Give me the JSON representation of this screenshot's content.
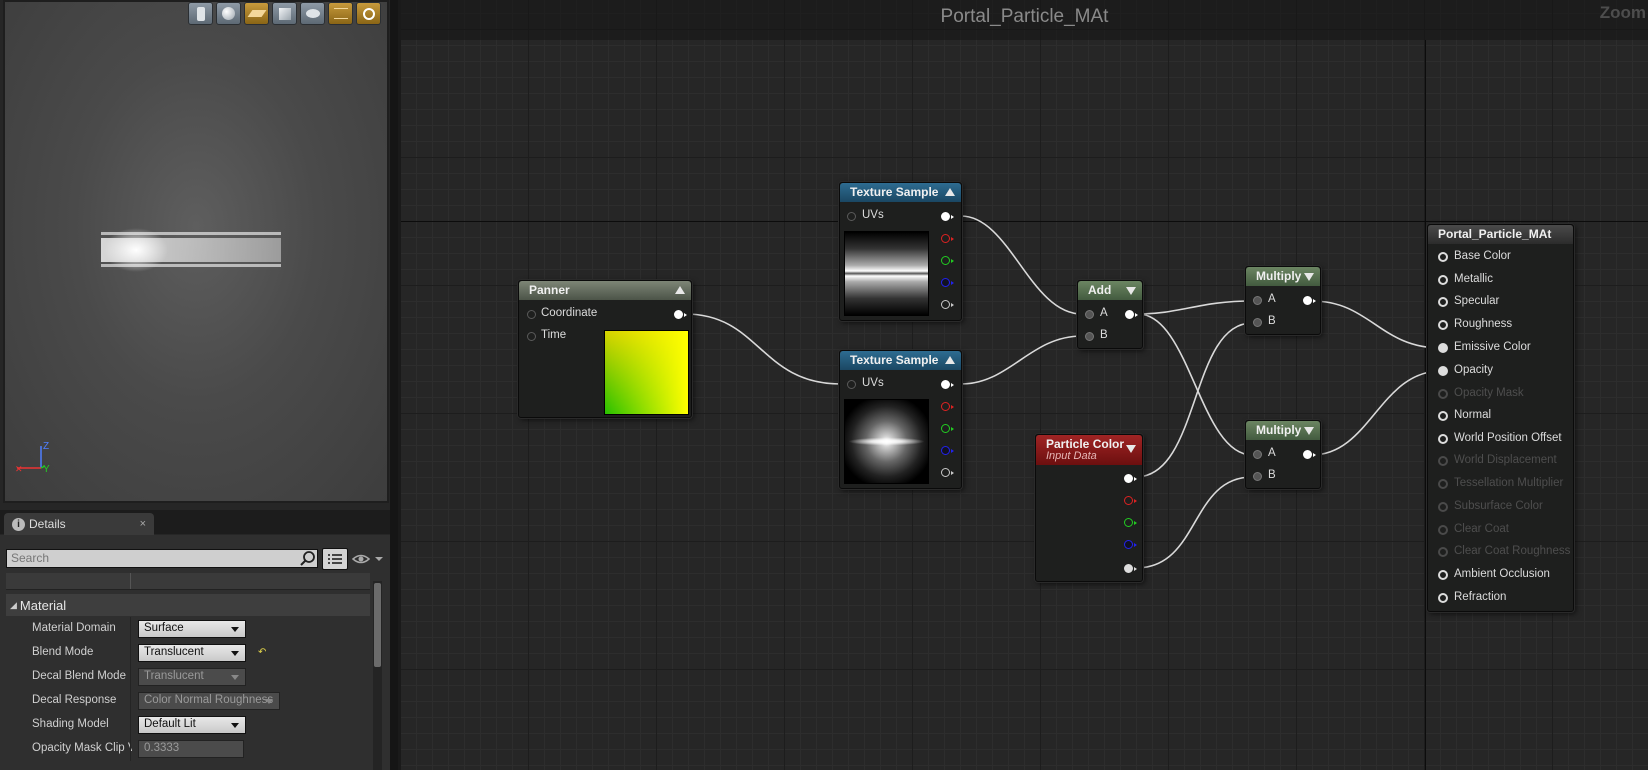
{
  "viewport": {
    "toolbar_icons": [
      "cylinder-icon",
      "sphere-icon",
      "plane-icon",
      "cube-icon",
      "custom-mesh-icon",
      "grid-icon",
      "realtime-icon"
    ]
  },
  "details": {
    "tab_label": "Details",
    "tab_close": "×",
    "search_placeholder": "Search",
    "section_title": "Material",
    "properties": [
      {
        "label": "Material Domain",
        "value": "Surface",
        "enabled": true
      },
      {
        "label": "Blend Mode",
        "value": "Translucent",
        "enabled": true,
        "reset": true
      },
      {
        "label": "Decal Blend Mode",
        "value": "Translucent",
        "enabled": false
      },
      {
        "label": "Decal Response",
        "value": "Color Normal Roughness",
        "enabled": false
      },
      {
        "label": "Shading Model",
        "value": "Default Lit",
        "enabled": true
      },
      {
        "label": "Opacity Mask Clip V",
        "value": "0.3333",
        "enabled": false
      }
    ],
    "axis_labels": {
      "z": "Z",
      "y": "Y"
    }
  },
  "graph": {
    "title": "Portal_Particle_MAt",
    "zoom_label": "Zoom",
    "nodes": {
      "panner": {
        "title": "Panner",
        "inputs": [
          "Coordinate",
          "Time"
        ]
      },
      "texture_sample_1": {
        "title": "Texture Sample",
        "inputs": [
          "UVs"
        ]
      },
      "texture_sample_2": {
        "title": "Texture Sample",
        "inputs": [
          "UVs"
        ]
      },
      "add": {
        "title": "Add",
        "inputs": [
          "A",
          "B"
        ]
      },
      "multiply_1": {
        "title": "Multiply",
        "inputs": [
          "A",
          "B"
        ]
      },
      "multiply_2": {
        "title": "Multiply",
        "inputs": [
          "A",
          "B"
        ]
      },
      "particle_color": {
        "title": "Particle Color",
        "subtitle": "Input Data"
      },
      "result": {
        "title": "Portal_Particle_MAt",
        "inputs": [
          {
            "label": "Base Color",
            "enabled": true
          },
          {
            "label": "Metallic",
            "enabled": true
          },
          {
            "label": "Specular",
            "enabled": true
          },
          {
            "label": "Roughness",
            "enabled": true
          },
          {
            "label": "Emissive Color",
            "enabled": true,
            "connected": true
          },
          {
            "label": "Opacity",
            "enabled": true,
            "connected": true
          },
          {
            "label": "Opacity Mask",
            "enabled": false
          },
          {
            "label": "Normal",
            "enabled": true
          },
          {
            "label": "World Position Offset",
            "enabled": true
          },
          {
            "label": "World Displacement",
            "enabled": false
          },
          {
            "label": "Tessellation Multiplier",
            "enabled": false
          },
          {
            "label": "Subsurface Color",
            "enabled": false
          },
          {
            "label": "Clear Coat",
            "enabled": false
          },
          {
            "label": "Clear Coat Roughness",
            "enabled": false
          },
          {
            "label": "Ambient Occlusion",
            "enabled": true
          },
          {
            "label": "Refraction",
            "enabled": true
          }
        ]
      }
    },
    "connections": [
      [
        "panner.Coordinate",
        "texture_sample_2.UVs"
      ],
      [
        "texture_sample_1.RGB",
        "add.A"
      ],
      [
        "texture_sample_2.RGB",
        "add.B"
      ],
      [
        "add.out",
        "multiply_1.A"
      ],
      [
        "add.out",
        "multiply_2.A"
      ],
      [
        "particle_color.RGB",
        "multiply_1.B"
      ],
      [
        "particle_color.A",
        "multiply_2.B"
      ],
      [
        "multiply_1.out",
        "result.Emissive Color"
      ],
      [
        "multiply_2.out",
        "result.Opacity"
      ]
    ],
    "colors": {
      "wire": "#d9d9d9",
      "texture_header": "#2e6c91",
      "math_header": "#6b8562",
      "particle_header": "#a02424"
    }
  }
}
